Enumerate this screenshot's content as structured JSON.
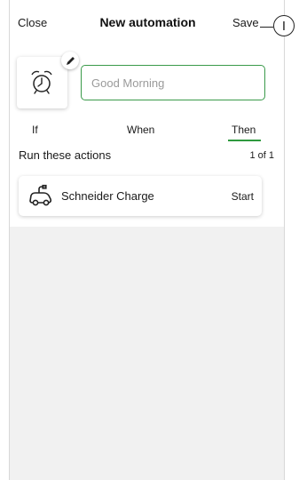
{
  "header": {
    "close_label": "Close",
    "title": "New automation",
    "save_label": "Save"
  },
  "callout": {
    "marker": "I"
  },
  "automation": {
    "icon": "alarm-clock-icon",
    "name_placeholder": "Good Morning",
    "name_value": ""
  },
  "tabs": [
    {
      "label": "If",
      "active": false
    },
    {
      "label": "When",
      "active": false
    },
    {
      "label": "Then",
      "active": true
    }
  ],
  "actions": {
    "section_title": "Run these actions",
    "count": "1 of 1",
    "items": [
      {
        "icon": "ev-charger-icon",
        "name": "Schneider Charge",
        "status": "Start"
      }
    ]
  },
  "colors": {
    "accent_green": "#2f9a3f",
    "input_border": "#3a9a4a",
    "empty_area": "#f1f1f1"
  }
}
